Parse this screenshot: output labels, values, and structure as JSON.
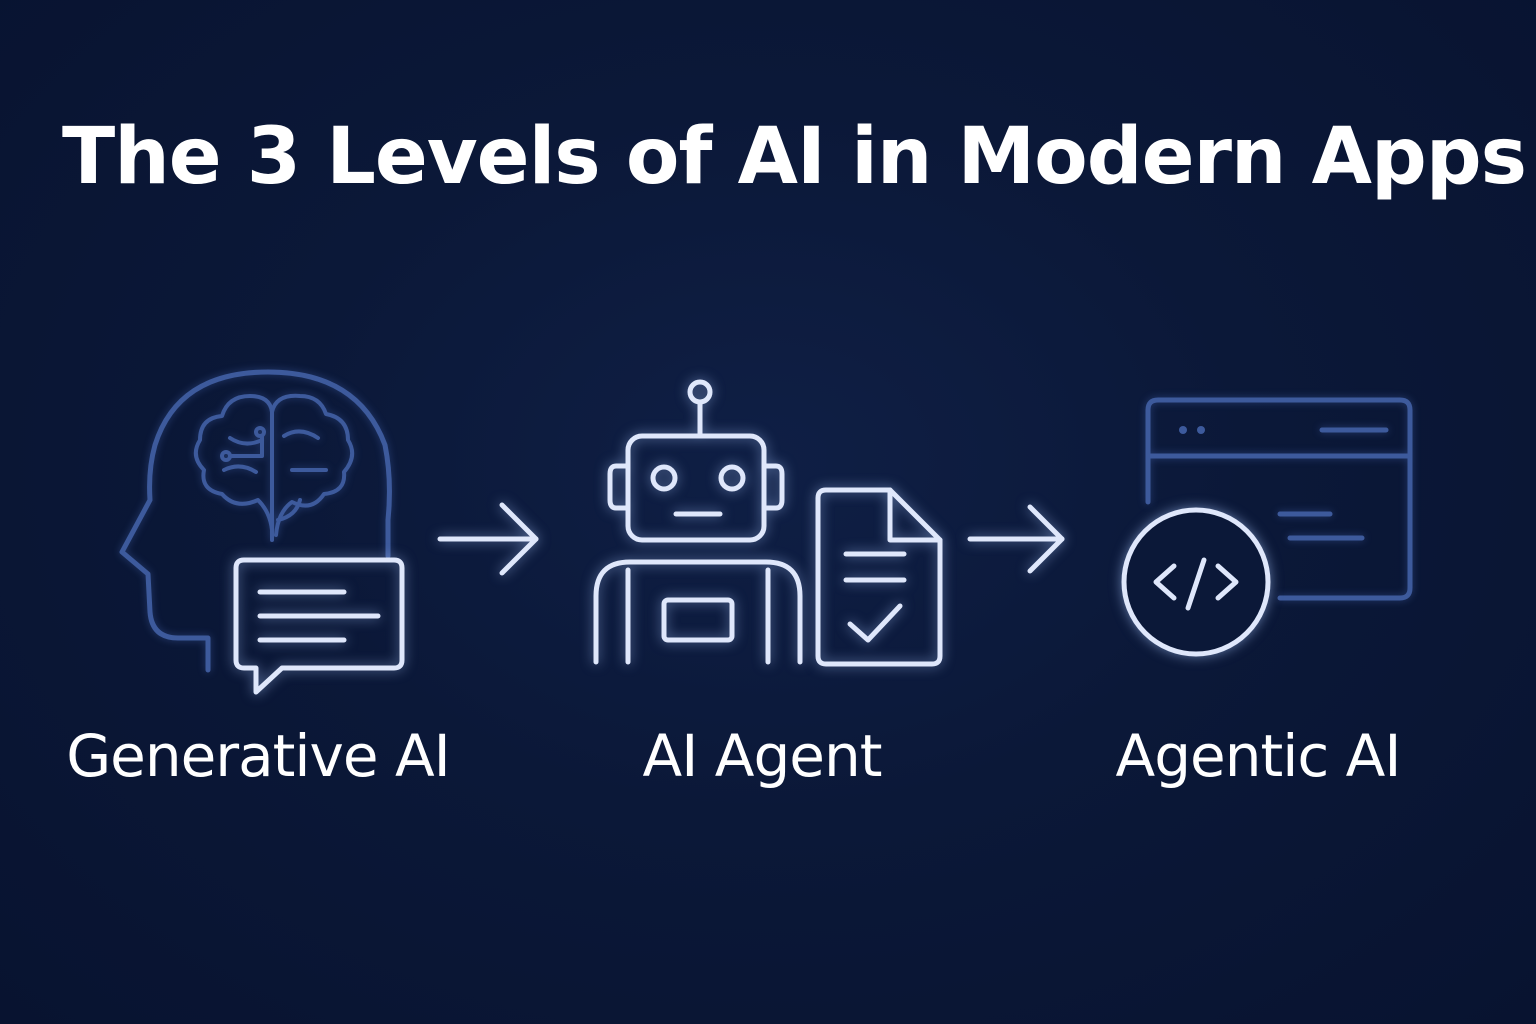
{
  "title": "The 3 Levels of AI in Modern Apps",
  "colors": {
    "background": "#0b1838",
    "icon_dim": "#3d5a9c",
    "icon_light": "#dfe7fb",
    "text": "#ffffff"
  },
  "stages": [
    {
      "label": "Generative AI",
      "icon": "head-brain-chat-icon"
    },
    {
      "label": "AI Agent",
      "icon": "robot-document-icon"
    },
    {
      "label": "Agentic AI",
      "icon": "browser-code-icon"
    }
  ]
}
